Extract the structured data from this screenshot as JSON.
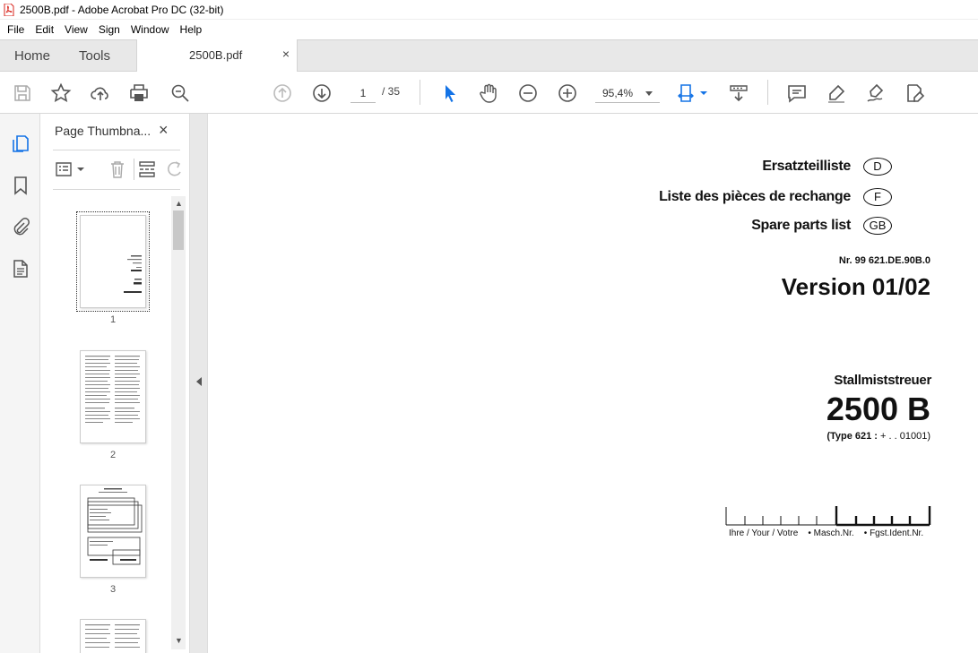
{
  "window": {
    "title": "2500B.pdf - Adobe Acrobat Pro DC (32-bit)"
  },
  "menubar": {
    "items": [
      "File",
      "Edit",
      "View",
      "Sign",
      "Window",
      "Help"
    ]
  },
  "tabs": {
    "home": "Home",
    "tools": "Tools",
    "document": "2500B.pdf",
    "close": "×"
  },
  "toolbar": {
    "current_page": "1",
    "total_pages": "/ 35",
    "zoom": "95,4%"
  },
  "thumbnails_panel": {
    "title": "Page Thumbna...",
    "close": "×",
    "pages": [
      "1",
      "2",
      "3"
    ]
  },
  "document": {
    "languages": [
      {
        "label": "Ersatzteilliste",
        "code": "D"
      },
      {
        "label": "Liste des pièces de rechange",
        "code": "F"
      },
      {
        "label": "Spare parts list",
        "code": "GB"
      }
    ],
    "number": "Nr. 99 621.DE.90B.0",
    "version": "Version 01/02",
    "product": "Stallmiststreuer",
    "model": "2500 B",
    "type_prefix": "(Type 621 :",
    "type_suffix": "+ . . 01001)",
    "serial_labels": "Ihre / Your / Votre    • Masch.Nr.    • Fgst.Ident.Nr."
  },
  "colors": {
    "accent": "#1473e6",
    "tabbar": "#e8e8e8",
    "pdf_red": "#d9241c"
  }
}
